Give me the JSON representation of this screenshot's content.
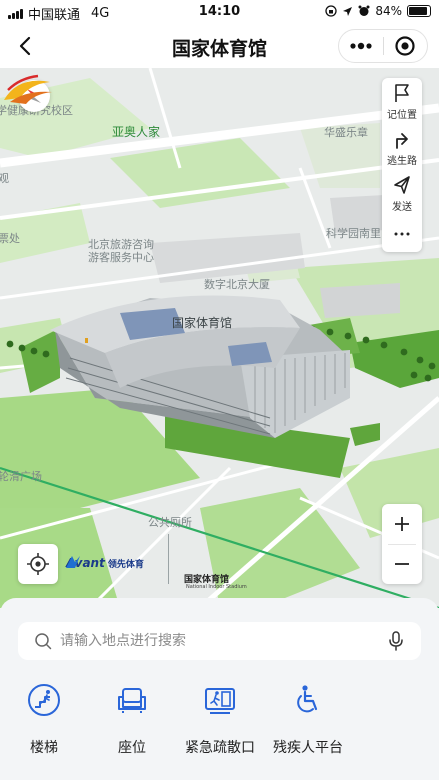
{
  "status_bar": {
    "carrier": "中国联通",
    "network": "4G",
    "time": "14:10",
    "battery": "84%",
    "battery_level": 0.84
  },
  "nav": {
    "title": "国家体育馆"
  },
  "map": {
    "labels": {
      "campus": "学健康研究校区",
      "asian_games": "亚奥人家",
      "huasheng": "华盛乐章",
      "guan": "观",
      "ticket": "票处",
      "tourist_center_1": "北京旅游咨询",
      "tourist_center_2": "游客服务中心",
      "digital_building": "数字北京大厦",
      "science_park": "科学园南里",
      "stadium": "国家体育馆",
      "skating": "轮滑广场",
      "toilet": "公共厕所"
    },
    "tools": {
      "mark_location": "记位置",
      "escape_route": "逃生路",
      "send": "发送"
    },
    "brand": {
      "avant": "Avant",
      "avant_cn": "领先体育",
      "stadium_cn": "国家体育馆",
      "stadium_en": "National Indoor Stadium"
    }
  },
  "search": {
    "placeholder": "请输入地点进行搜索",
    "value": ""
  },
  "quick_actions": [
    {
      "label": "楼梯",
      "icon": "stairs-icon"
    },
    {
      "label": "座位",
      "icon": "seat-icon"
    },
    {
      "label": "紧急疏散口",
      "icon": "emergency-exit-icon"
    },
    {
      "label": "残疾人平台",
      "icon": "accessibility-icon"
    }
  ],
  "colors": {
    "accent": "#2a66d9",
    "park_green": "#a7d985",
    "lawn_green": "#5da53a"
  }
}
